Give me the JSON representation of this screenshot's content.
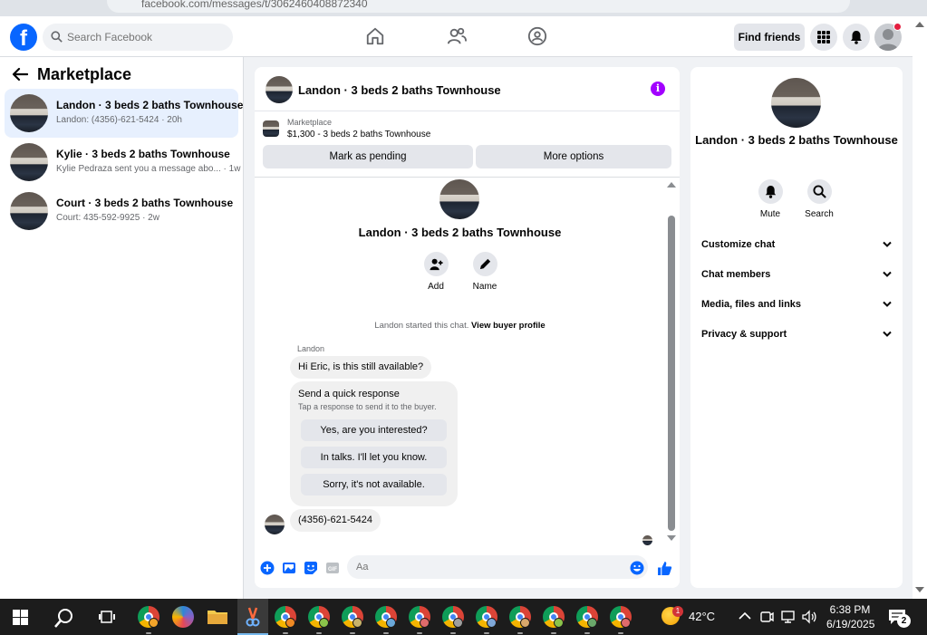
{
  "browser": {
    "url": "facebook.com/messages/t/3062460408872340"
  },
  "topnav": {
    "search_placeholder": "Search Facebook",
    "find_friends": "Find friends"
  },
  "sidebar": {
    "title": "Marketplace",
    "conversations": [
      {
        "name": "Landon · 3 beds 2 baths Townhouse",
        "preview": "Landon: (4356)-621-5424 · 20h",
        "active": true
      },
      {
        "name": "Kylie · 3 beds 2 baths Townhouse",
        "preview": "Kylie Pedraza sent you a message abo... · 1w",
        "active": false
      },
      {
        "name": "Court · 3 beds 2 baths Townhouse",
        "preview": "Court: 435-592-9925 · 2w",
        "active": false
      }
    ]
  },
  "chat": {
    "header_title": "Landon · 3 beds 2 baths Townhouse",
    "listing_source": "Marketplace",
    "listing_price_title": "$1,300 - 3 beds 2 baths Townhouse",
    "mark_pending": "Mark as pending",
    "more_options": "More options",
    "profile_name": "Landon · 3 beds 2 baths Townhouse",
    "actions": {
      "add": "Add",
      "name": "Name"
    },
    "started_text": "Landon started this chat. ",
    "view_profile": "View buyer profile",
    "sender": "Landon",
    "message1": "Hi Eric, is this still available?",
    "quick_title": "Send a quick response",
    "quick_sub": "Tap a response to send it to the buyer.",
    "quick_responses": [
      "Yes, are you interested?",
      "In talks. I'll let you know.",
      "Sorry, it's not available."
    ],
    "message2": "(4356)-621-5424",
    "composer_placeholder": "Aa"
  },
  "info_panel": {
    "name": "Landon · 3 beds 2 baths Townhouse",
    "mute": "Mute",
    "search": "Search",
    "rows": [
      "Customize chat",
      "Chat members",
      "Media, files and links",
      "Privacy & support"
    ]
  },
  "taskbar": {
    "temperature": "42°C",
    "weather_badge": "1",
    "time": "6:38 PM",
    "date": "6/19/2025",
    "notifications": "2"
  },
  "colors": {
    "fb_blue": "#0866ff",
    "active_row": "#e7f0fe",
    "info_purple": "#a200ff"
  }
}
